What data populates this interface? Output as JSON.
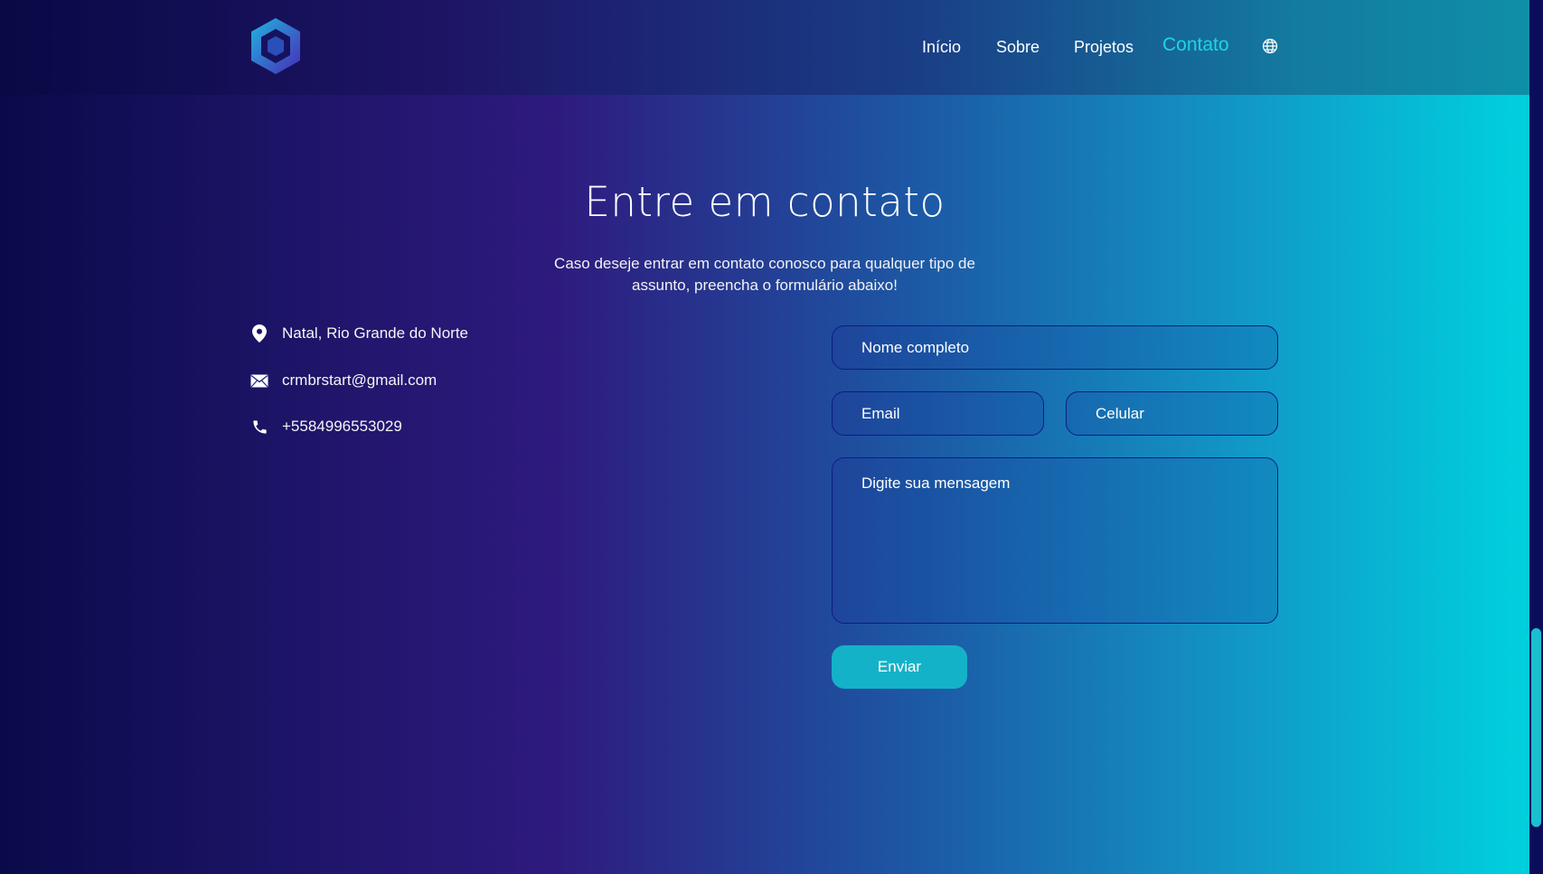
{
  "nav": {
    "links": [
      "Início",
      "Sobre",
      "Projetos",
      "Contato"
    ],
    "active": "Contato"
  },
  "contact": {
    "title": "Entre em contato",
    "subtitle": "Caso deseje entrar em contato conosco para qualquer tipo de assunto, preencha o formulário abaixo!",
    "location": "Natal, Rio Grande do Norte",
    "email": "crmbrstart@gmail.com",
    "phone": "+5584996553029"
  },
  "form": {
    "name_placeholder": "Nome completo",
    "email_placeholder": "Email",
    "phone_placeholder": "Celular",
    "message_placeholder": "Digite sua mensagem",
    "submit_label": "Enviar"
  },
  "colors": {
    "accent": "#20d3e6",
    "button": "#14b2c8",
    "field_border": "#0c1c86"
  },
  "icons": [
    "logo-hexagon",
    "globe-icon",
    "location-pin-icon",
    "envelope-icon",
    "phone-icon"
  ]
}
